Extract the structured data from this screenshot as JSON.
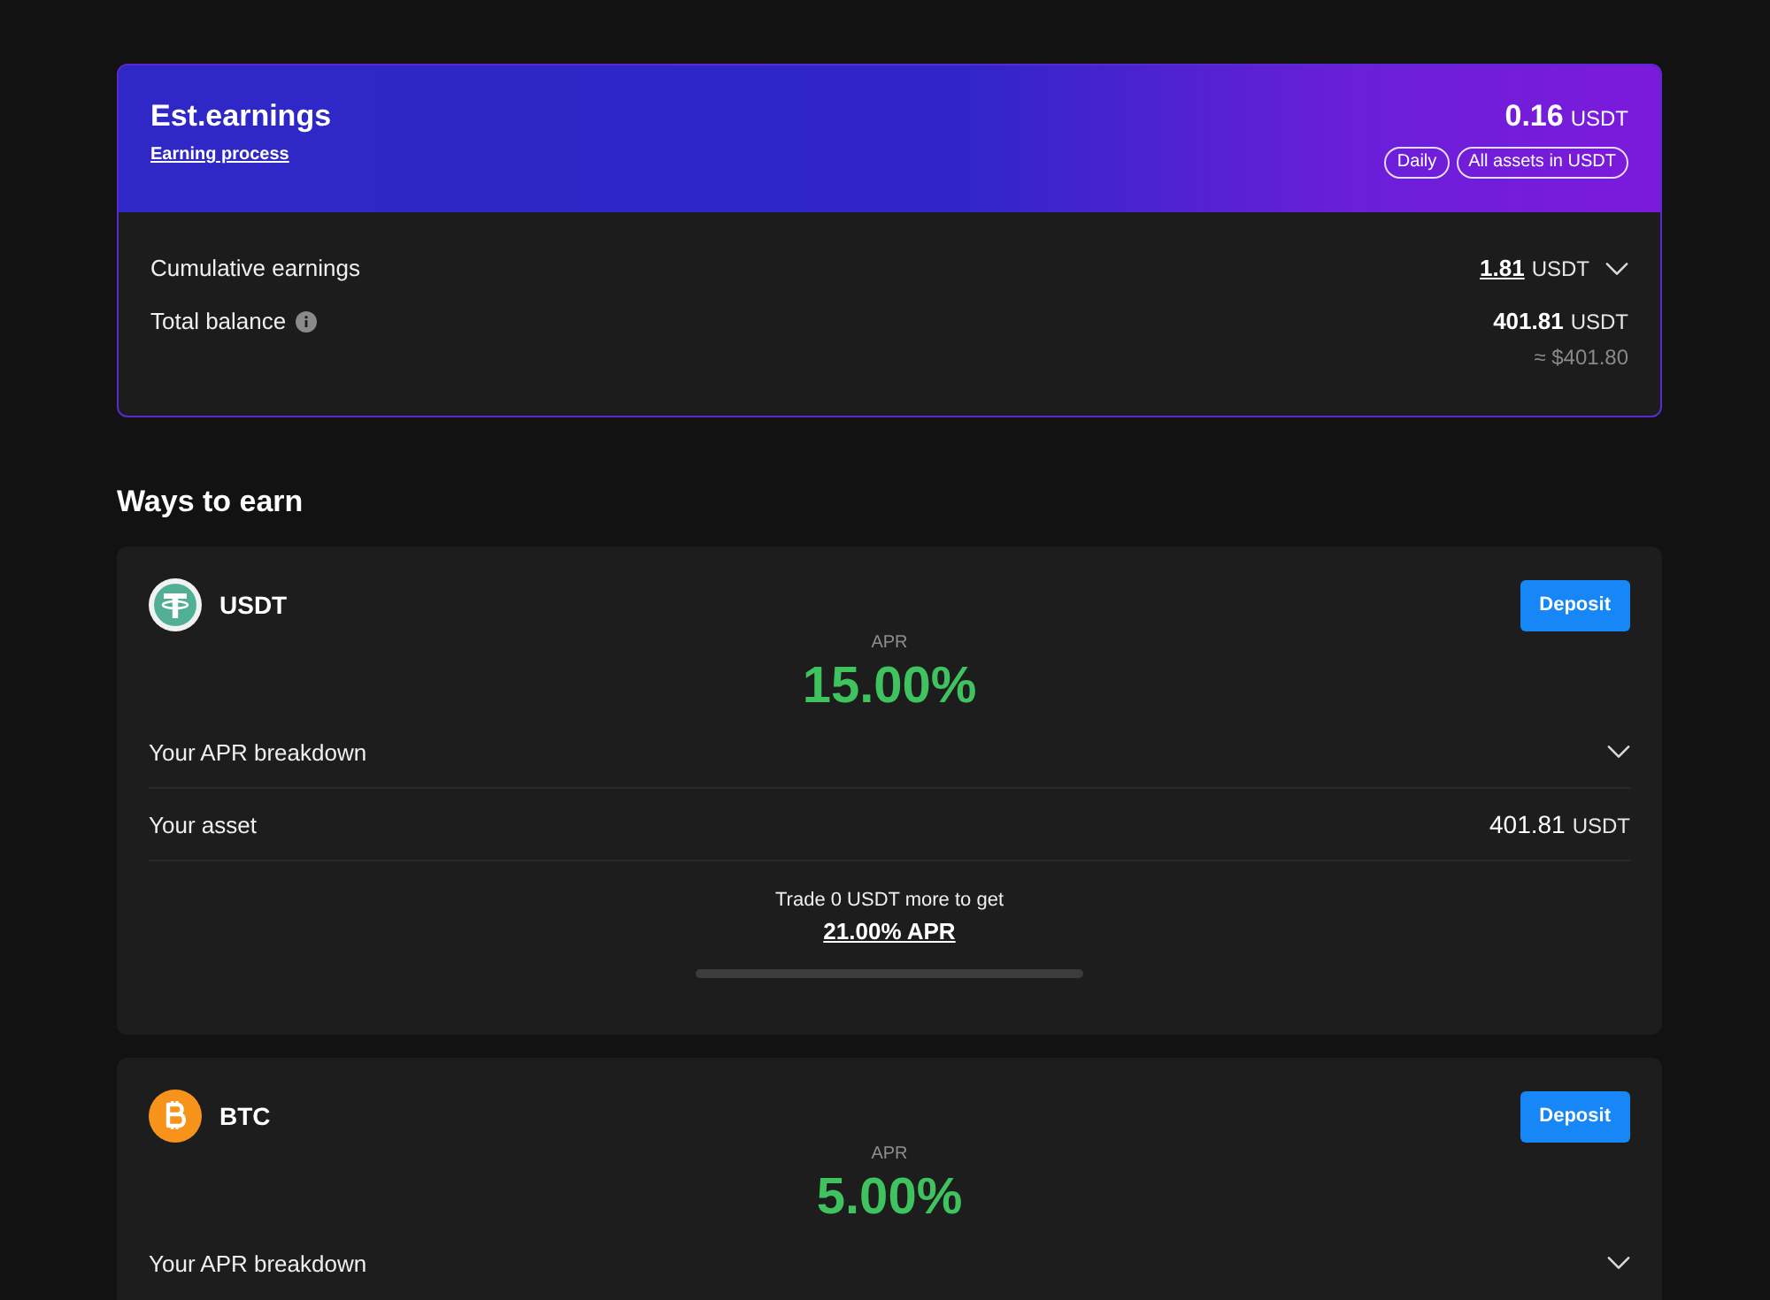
{
  "summary": {
    "title": "Est.earnings",
    "link": "Earning process",
    "amount": "0.16",
    "unit": "USDT",
    "tags": [
      "Daily",
      "All assets in USDT"
    ],
    "rows": [
      {
        "kind": "expand",
        "label": "Cumulative earnings",
        "value": "1.81",
        "unit": "USDT",
        "expanded": false
      },
      {
        "kind": "info",
        "label": "Total balance",
        "value": "401.81",
        "unit": "USDT",
        "note": "≈ $401.80"
      }
    ]
  },
  "section_title": "Ways to earn",
  "products": [
    {
      "kind": "tether",
      "coin": "USDT",
      "button": "Deposit",
      "apr_label": "APR",
      "apr": "15.00%",
      "rows": [
        {
          "kind": "breakdown",
          "label": "Your APR breakdown",
          "expanded": false
        },
        {
          "kind": "asset",
          "label": "Your asset",
          "value": "401.81",
          "unit": "USDT"
        }
      ],
      "promo": {
        "text": "Trade 0 USDT more to get",
        "target": "21.00% APR"
      }
    },
    {
      "kind": "bitcoin",
      "coin": "BTC",
      "button": "Deposit",
      "apr_label": "APR",
      "apr": "5.00%",
      "rows": [
        {
          "kind": "breakdown",
          "label": "Your APR breakdown",
          "expanded": false
        }
      ]
    }
  ]
}
